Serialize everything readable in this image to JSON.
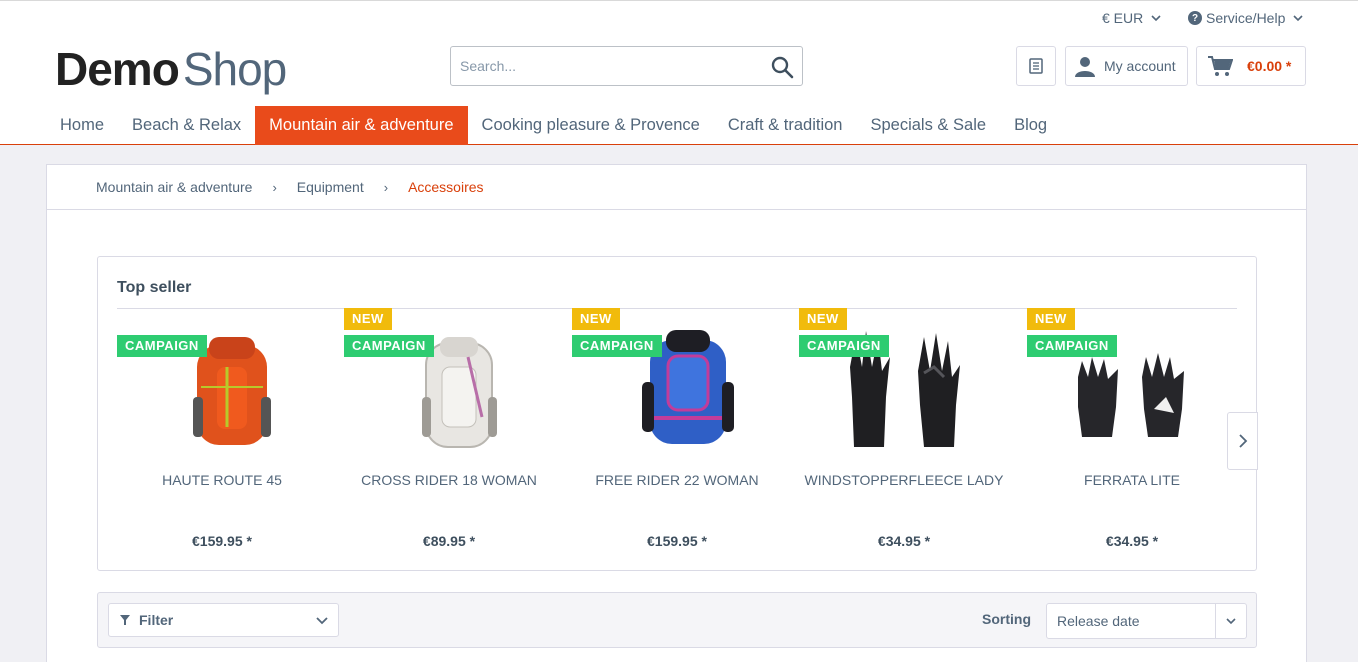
{
  "topbar": {
    "currency": "€ EUR",
    "service": "Service/Help"
  },
  "logo": {
    "part1": "Demo",
    "part2": "Shop"
  },
  "search": {
    "placeholder": "Search..."
  },
  "header_buttons": {
    "account": "My account",
    "cart_amount": "€0.00 *"
  },
  "nav": {
    "items": [
      "Home",
      "Beach & Relax",
      "Mountain air & adventure",
      "Cooking pleasure & Provence",
      "Craft & tradition",
      "Specials & Sale",
      "Blog"
    ],
    "active_index": 2
  },
  "breadcrumb": [
    "Mountain air & adventure",
    "Equipment",
    "Accessoires"
  ],
  "topseller": {
    "title": "Top seller",
    "products": [
      {
        "name": "HAUTE ROUTE 45",
        "price": "€159.95 *",
        "badges": [
          "CAMPAIGN"
        ],
        "icon": "orange-backpack-image"
      },
      {
        "name": "CROSS RIDER 18 WOMAN",
        "price": "€89.95 *",
        "badges": [
          "NEW",
          "CAMPAIGN"
        ],
        "icon": "white-backpack-image"
      },
      {
        "name": "FREE RIDER 22 WOMAN",
        "price": "€159.95 *",
        "badges": [
          "NEW",
          "CAMPAIGN"
        ],
        "icon": "blue-backpack-image"
      },
      {
        "name": "WINDSTOPPERFLEECE LADY",
        "price": "€34.95 *",
        "badges": [
          "NEW",
          "CAMPAIGN"
        ],
        "icon": "black-gloves-image"
      },
      {
        "name": "FERRATA LITE",
        "price": "€34.95 *",
        "badges": [
          "NEW",
          "CAMPAIGN"
        ],
        "icon": "fingerless-gloves-image"
      }
    ]
  },
  "filterbar": {
    "filter_label": "Filter",
    "sorting_label": "Sorting",
    "sorting_value": "Release date"
  },
  "colors": {
    "accent": "#e94b1b",
    "badge_new": "#f1bb0c",
    "badge_campaign": "#2ecc71",
    "text": "#52667a"
  }
}
